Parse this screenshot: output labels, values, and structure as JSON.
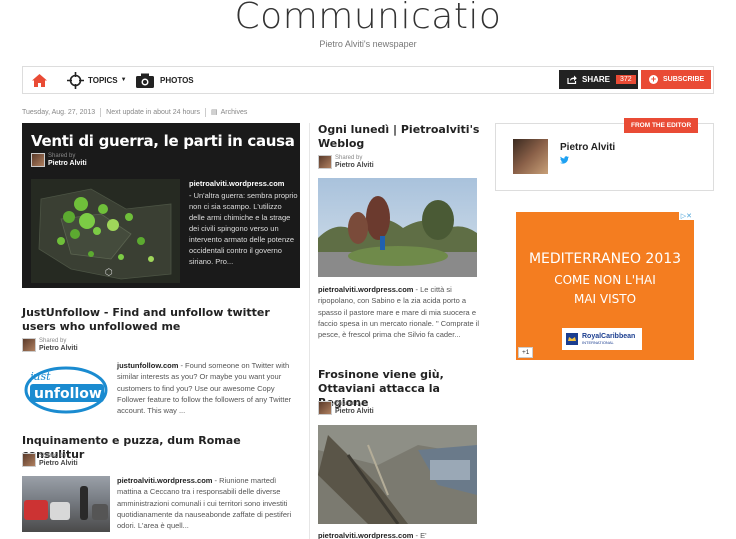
{
  "site": {
    "title": "Communicatio",
    "subtitle": "Pietro Alviti's newspaper"
  },
  "nav": {
    "topics_label": "TOPICS",
    "photos_label": "PHOTOS",
    "share_label": "SHARE",
    "share_count": "372",
    "subscribe_label": "SUBSCRIBE",
    "icons": [
      "home-icon",
      "crosshair-icon",
      "camera-icon",
      "share-icon",
      "plus-circle-icon"
    ]
  },
  "meta": {
    "date": "Tuesday, Aug. 27, 2013",
    "next_update": "Next update in about 24 hours",
    "archives": "Archives"
  },
  "shared": {
    "label": "Shared by",
    "name": "Pietro Alviti"
  },
  "feature": {
    "title": "Venti di guerra, le parti in causa",
    "source": "pietroalviti.wordpress.com",
    "description": " - Un'altra guerra: sembra proprio non ci sia scampo. L'utilizzo delle armi chimiche e la strage dei civili spingono verso un intervento armato delle potenze occidentali contro il governo siriano. Pro..."
  },
  "articles": [
    {
      "title": "JustUnfollow - Find and unfollow twitter users who unfollowed me",
      "source": "justunfollow.com",
      "description": " - Found someone on Twitter with similar interests as you? Or maybe you want your customers to find you? Use our awesome Copy Follower feature to follow the followers of any Twitter account. This way ...",
      "logo_text": "just",
      "logo_text2": "unfollow"
    },
    {
      "title": "Inquinamento e puzza, dum Romae consulitur",
      "source": "pietroalviti.wordpress.com",
      "description": " - Riunione martedì mattina a Ceccano tra i responsabili delle diverse amministrazioni comunali i cui territori sono investiti quotidianamente da nauseabonde zaffate di pestiferi odori. L'area è quell..."
    },
    {
      "title": "Ogni lunedì | Pietroalviti's Weblog",
      "source": "pietroalviti.wordpress.com",
      "description": " - Le città si ripopolano, con Sabino e la zia acida porto a spasso il pastore mare e mare di mia suocera e faccio spesa in un mercato rionale. \" Comprate il pesce, è frescol prima che Silvio fa cader..."
    },
    {
      "title": "Frosinone viene giù, Ottaviani attacca la Regione",
      "source": "pietroalviti.wordpress.com",
      "description": " - E'"
    }
  ],
  "editor": {
    "tag": "FROM THE EDITOR",
    "name": "Pietro Alviti"
  },
  "ad": {
    "line1": "MEDITERRANEO 2013",
    "line2": "COME NON L'HAI",
    "line3": "MAI VISTO",
    "brand": "RoyalCaribbean",
    "brand_sub": "INTERNATIONAL",
    "choices": "▷✕",
    "plus": "+1"
  },
  "colors": {
    "accent": "#e94b35",
    "dark": "#1a1a1a",
    "ad_orange": "#f47d20",
    "twitter": "#1da1f2"
  }
}
